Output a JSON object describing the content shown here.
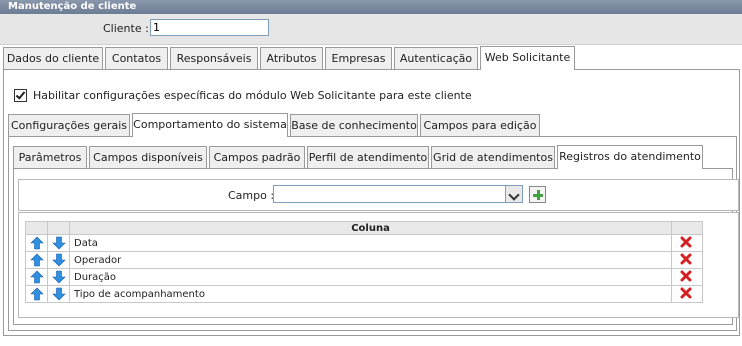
{
  "window": {
    "title": "Manutenção de cliente"
  },
  "cliente": {
    "label": "Cliente :",
    "value": "1"
  },
  "tabs_main": [
    "Dados do cliente",
    "Contatos",
    "Responsáveis",
    "Atributos",
    "Empresas",
    "Autenticação",
    "Web Solicitante"
  ],
  "checkbox": {
    "label": "Habilitar configurações específicas do módulo Web Solicitante para este cliente",
    "checked": true
  },
  "tabs_sub": [
    "Configurações gerais",
    "Comportamento do sistema",
    "Base de conhecimento",
    "Campos para edição"
  ],
  "tabs_sub2": [
    "Parâmetros",
    "Campos disponíveis",
    "Campos padrão",
    "Perfil de atendimento",
    "Grid de atendimentos",
    "Registros do atendimento"
  ],
  "campo": {
    "label": "Campo :",
    "value": ""
  },
  "table": {
    "header": "Coluna",
    "rows": [
      "Data",
      "Operador",
      "Duração",
      "Tipo de acompanhamento"
    ]
  },
  "icons": {
    "up": "arrow-up-icon",
    "down": "arrow-down-icon",
    "delete": "delete-x-icon",
    "add": "add-plus-icon"
  },
  "colors": {
    "titlebar": "#6d7c93",
    "arrow": "#2f8fe0",
    "delete": "#d42020",
    "add": "#3fa33f"
  }
}
